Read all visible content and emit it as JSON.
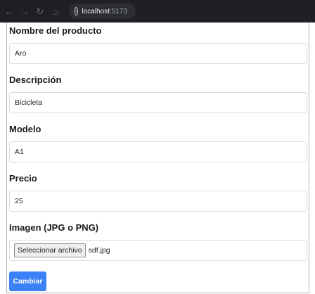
{
  "browser": {
    "host": "localhost",
    "port": ":5173"
  },
  "form": {
    "fields": [
      {
        "label": "Nombre del producto",
        "value": "Aro"
      },
      {
        "label": "Descripción",
        "value": "Bicicleta"
      },
      {
        "label": "Modelo",
        "value": "A1"
      },
      {
        "label": "Precio",
        "value": "25"
      }
    ],
    "image": {
      "label": "Imagen (JPG o PNG)",
      "button_label": "Seleccionar archivo",
      "file_name": "sdf.jpg"
    },
    "submit_label": "Cambiar"
  }
}
